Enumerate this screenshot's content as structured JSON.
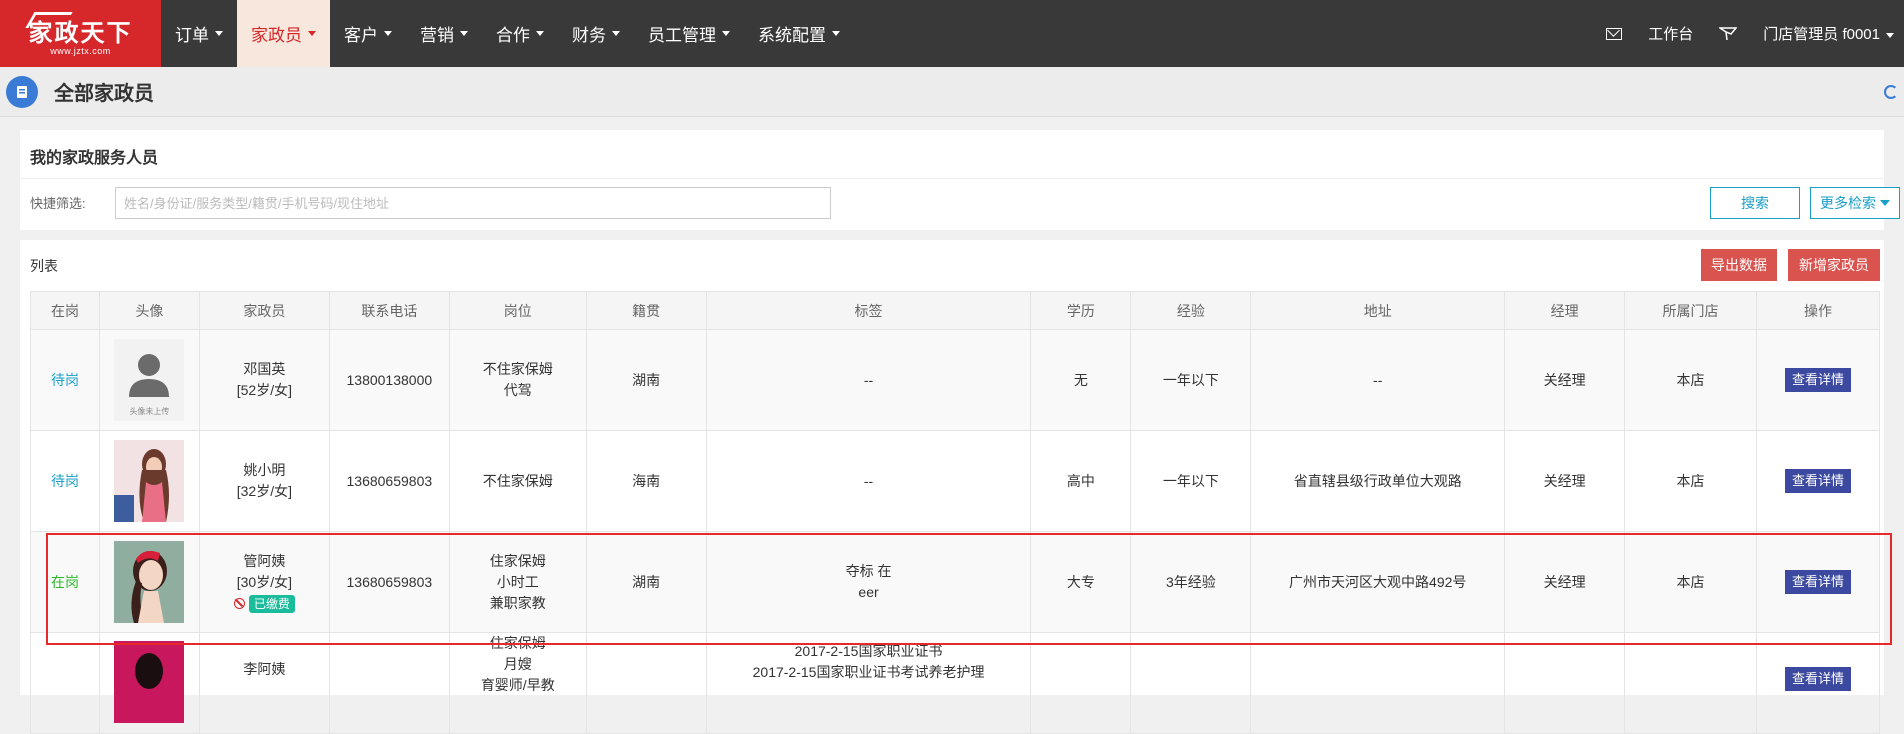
{
  "brand": {
    "name": "家政天下",
    "url": "www.jztx.com"
  },
  "topnav": {
    "menu": [
      {
        "label": "订单",
        "active": false
      },
      {
        "label": "家政员",
        "active": true
      },
      {
        "label": "客户",
        "active": false
      },
      {
        "label": "营销",
        "active": false
      },
      {
        "label": "合作",
        "active": false
      },
      {
        "label": "财务",
        "active": false
      },
      {
        "label": "员工管理",
        "active": false
      },
      {
        "label": "系统配置",
        "active": false
      }
    ],
    "workbench": "工作台",
    "user": "门店管理员 f0001"
  },
  "page": {
    "title": "全部家政员"
  },
  "filter": {
    "title": "我的家政服务人员",
    "quick_label": "快捷筛选:",
    "search_placeholder": "姓名/身份证/服务类型/籍贯/手机号码/现住地址",
    "search_button": "搜索",
    "more_button": "更多检索"
  },
  "list": {
    "title": "列表",
    "export_button": "导出数据",
    "add_button": "新增家政员",
    "columns": [
      "在岗",
      "头像",
      "家政员",
      "联系电话",
      "岗位",
      "籍贯",
      "标签",
      "学历",
      "经验",
      "地址",
      "经理",
      "所属门店",
      "操作"
    ],
    "rows": [
      {
        "status": "待岗",
        "avatar_text": "头像未上传",
        "name": "邓国英",
        "meta": "[52岁/女]",
        "phone": "13800138000",
        "post": [
          "不住家保姆",
          "代驾"
        ],
        "origin": "湖南",
        "tags": [
          "--"
        ],
        "edu": "无",
        "exp": "一年以下",
        "addr": "--",
        "manager": "关经理",
        "store": "本店",
        "action": "查看详情"
      },
      {
        "status": "待岗",
        "name": "姚小明",
        "meta": "[32岁/女]",
        "phone": "13680659803",
        "post": [
          "不住家保姆"
        ],
        "origin": "海南",
        "tags": [
          "--"
        ],
        "edu": "高中",
        "exp": "一年以下",
        "addr": "省直辖县级行政单位大观路",
        "manager": "关经理",
        "store": "本店",
        "action": "查看详情"
      },
      {
        "status": "在岗",
        "name": "管阿姨",
        "meta": "[30岁/女]",
        "badge": "已缴费",
        "phone": "13680659803",
        "post": [
          "住家保姆",
          "小时工",
          "兼职家教"
        ],
        "origin": "湖南",
        "tags": [
          "夺标 在",
          "eer"
        ],
        "edu": "大专",
        "exp": "3年经验",
        "addr": "广州市天河区大观中路492号",
        "manager": "关经理",
        "store": "本店",
        "action": "查看详情"
      },
      {
        "status": "",
        "name": "李阿姨",
        "meta": "",
        "phone": "",
        "post": [
          "住家保姆",
          "月嫂",
          "育婴师/早教"
        ],
        "origin": "",
        "tags": [
          "2017-2-15国家职业证书",
          "2017-2-15国家职业证书考试养老护理"
        ],
        "edu": "",
        "exp": "",
        "addr": "",
        "manager": "",
        "store": "",
        "action": "查看详情"
      }
    ]
  }
}
